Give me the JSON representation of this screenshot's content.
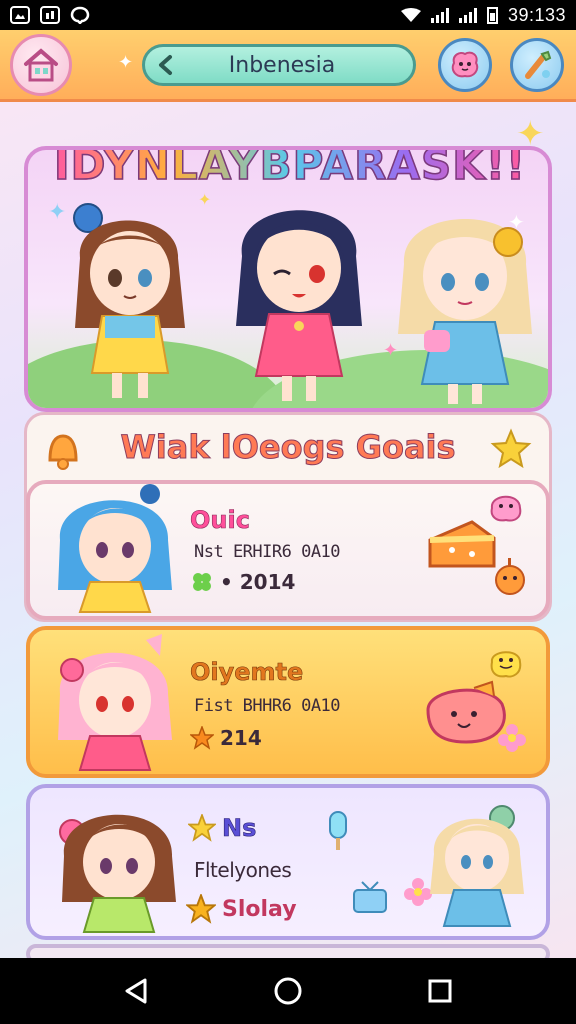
{
  "status_bar": {
    "time": "39:133",
    "left_icons": [
      "gallery-app-icon",
      "photo-app-icon",
      "messenger-app-icon"
    ],
    "right_icons": [
      "wifi-icon",
      "signal-icon",
      "signal-icon",
      "battery-icon"
    ]
  },
  "header": {
    "language_label": "Inbenesia",
    "home_icon": "house-icon",
    "buttons": [
      "pink-blob-icon",
      "brush-icon"
    ]
  },
  "banner": {
    "title": "IDYNLAYBPARASK!!"
  },
  "section": {
    "title": "Wiak lOeogs Goais"
  },
  "cards": [
    {
      "name": "Ouic",
      "name_color": "#ff4f9a",
      "subtitle": "Nst ERHIR6 0A10",
      "stat_icon": "clover-icon",
      "stat": "• 2014"
    },
    {
      "name": "Oiyemte",
      "name_color": "#e2771f",
      "subtitle": "Fist BHHR6 0A10",
      "stat_icon": "star-icon",
      "stat": "214"
    },
    {
      "name": "Ns",
      "name_color": "#5a4fd6",
      "subtitle": "Fltelyones",
      "stat_icon": "star-icon",
      "stat": "Slolay"
    }
  ],
  "colors": {
    "header": "#ffb85f",
    "accent_pink": "#ff5ba0",
    "accent_teal": "#7fdcc6",
    "card_gold": "#ffc24d",
    "card_lavender": "#eee6ff"
  },
  "nav_bar": [
    "back-icon",
    "home-icon",
    "recents-icon"
  ]
}
